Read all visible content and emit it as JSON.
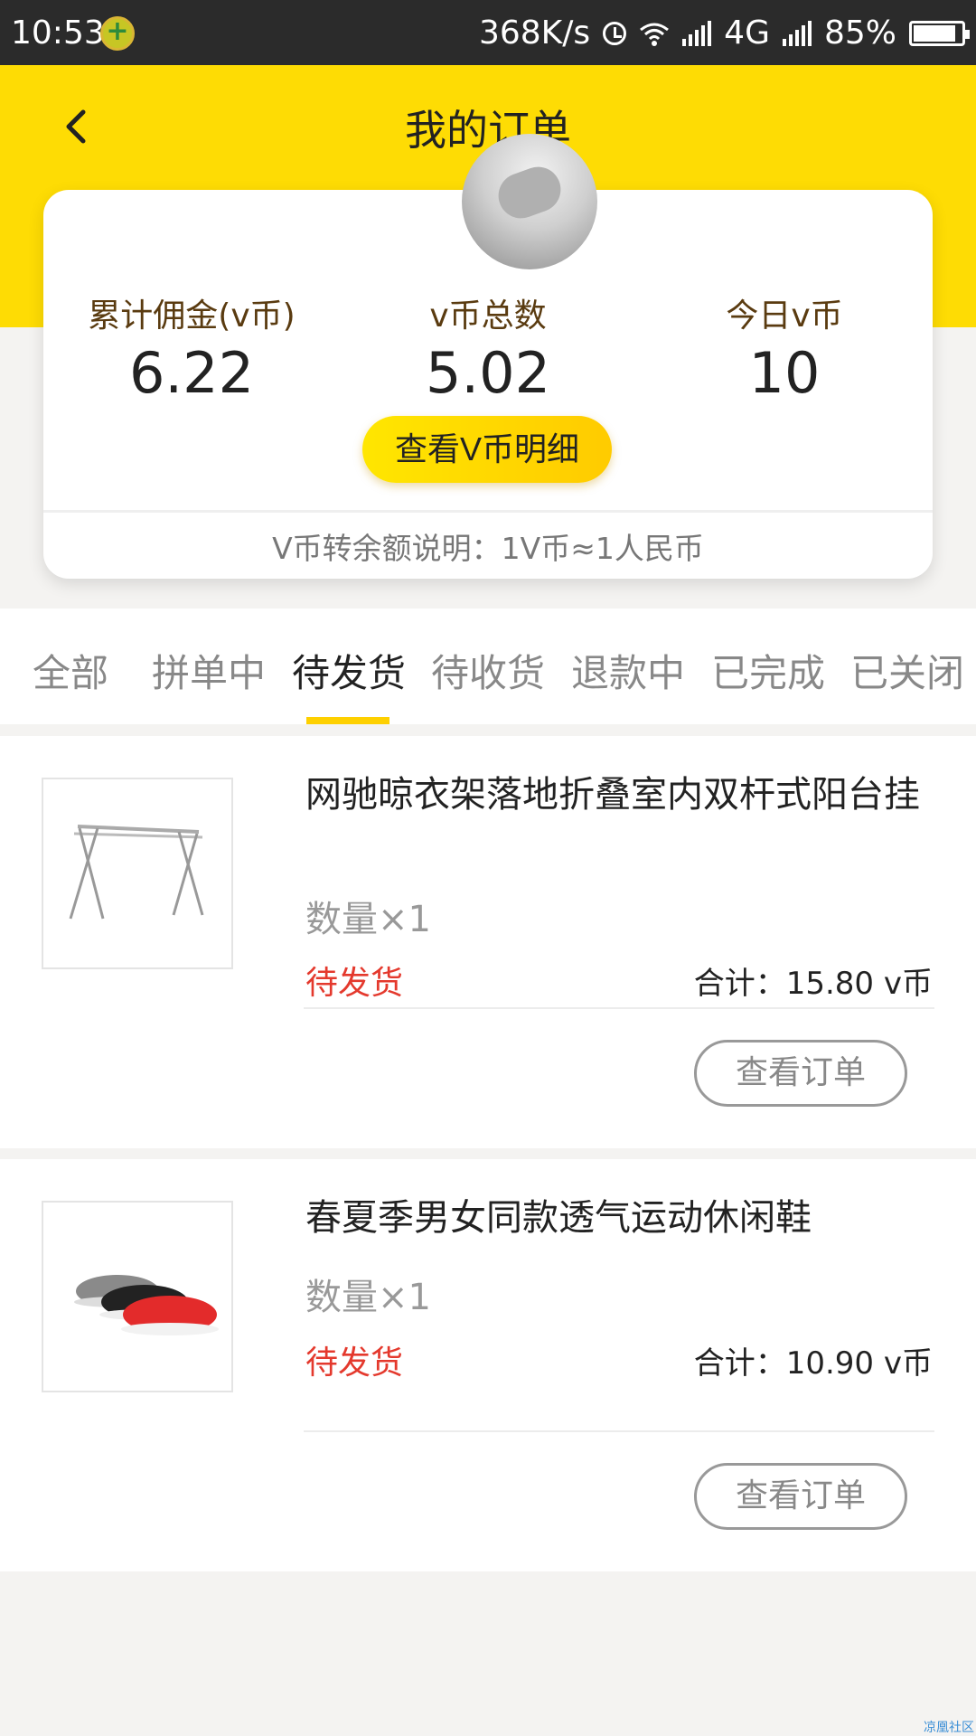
{
  "status_bar": {
    "time": "10:53",
    "speed": "368K/s",
    "network": "4G",
    "battery": "85%",
    "battery_level": 0.85
  },
  "header": {
    "title": "我的订单"
  },
  "summary": {
    "stats": [
      {
        "label": "累计佣金(v币)",
        "value": "6.22"
      },
      {
        "label": "v币总数",
        "value": "5.02"
      },
      {
        "label": "今日v币",
        "value": "10"
      }
    ],
    "detail_button": "查看V币明细",
    "note": "V币转余额说明：1V币≈1人民币"
  },
  "tabs": [
    "全部",
    "拼单中",
    "待发货",
    "待收货",
    "退款中",
    "已完成",
    "已关闭"
  ],
  "active_tab": "待发货",
  "orders": [
    {
      "name": "网驰晾衣架落地折叠室内双杆式阳台挂",
      "quantity": "数量×1",
      "status": "待发货",
      "total": "合计：15.80 v币",
      "button": "查看订单"
    },
    {
      "name": "春夏季男女同款透气运动休闲鞋",
      "quantity": "数量×1",
      "status": "待发货",
      "total": "合计：10.90 v币",
      "button": "查看订单"
    }
  ],
  "watermark": "凉凰社区",
  "colors": {
    "header": "#fedc04",
    "status": "#e4392d",
    "underline": "#fed000"
  }
}
